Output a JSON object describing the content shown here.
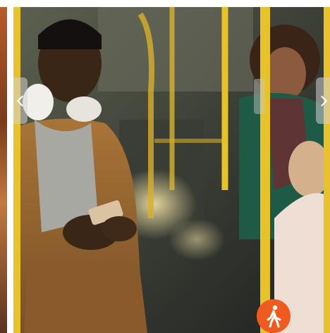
{
  "image": {
    "alt": "",
    "badge_icon": "pedestrian-walking-icon",
    "nav_icons": [
      "chevron-left-icon",
      "chevron-right-icon"
    ],
    "colors": {
      "badge": "#ef5a1e",
      "pole": "#e8c22a",
      "coat": "#9c6a34"
    }
  }
}
